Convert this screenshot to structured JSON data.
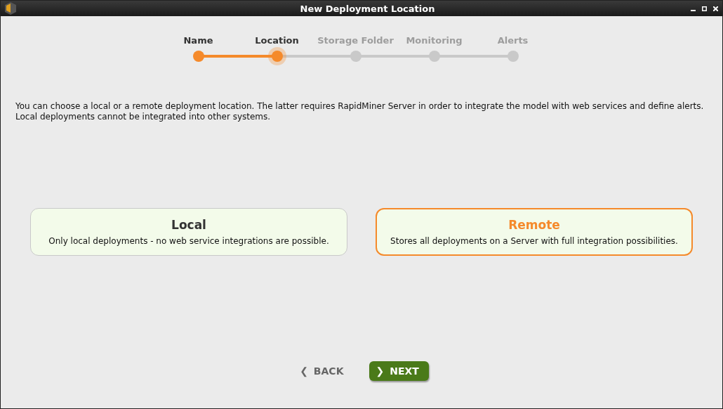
{
  "window": {
    "title": "New Deployment Location"
  },
  "steps": [
    {
      "label": "Name",
      "kind": "done"
    },
    {
      "label": "Location",
      "kind": "current"
    },
    {
      "label": "Storage Folder",
      "kind": "todo"
    },
    {
      "label": "Monitoring",
      "kind": "todo"
    },
    {
      "label": "Alerts",
      "kind": "todo"
    }
  ],
  "description": "You can choose a local or a remote deployment location. The latter requires RapidMiner Server in order to integrate the model with web services and define alerts. Local deployments cannot be integrated into other systems.",
  "options": [
    {
      "title": "Local",
      "text": "Only local deployments - no web service integrations are possible.",
      "selected": false
    },
    {
      "title": "Remote",
      "text": "Stores all deployments on a Server with full integration possibilities.",
      "selected": true
    }
  ],
  "buttons": [
    {
      "icon": "❮",
      "label": "BACK",
      "kind": "secondary"
    },
    {
      "icon": "❯",
      "label": "NEXT",
      "kind": "primary"
    }
  ]
}
